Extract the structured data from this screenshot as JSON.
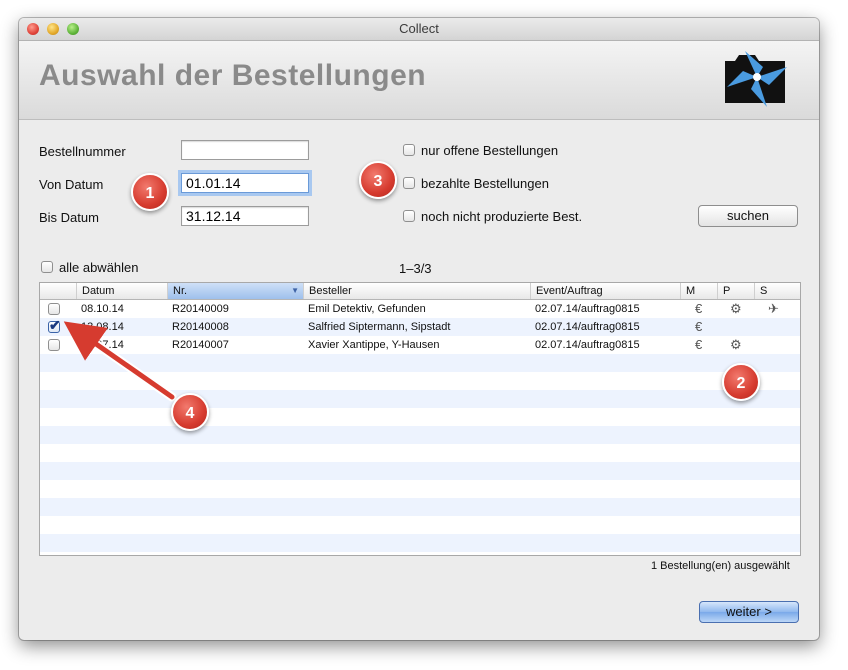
{
  "window": {
    "title": "Collect"
  },
  "header": {
    "title": "Auswahl der Bestellungen"
  },
  "form": {
    "order_number_label": "Bestellnummer",
    "order_number_value": "",
    "from_date_label": "Von Datum",
    "from_date_value": "01.01.14",
    "to_date_label": "Bis Datum",
    "to_date_value": "31.12.14"
  },
  "filters": {
    "open_orders": {
      "label": "nur offene Bestellungen",
      "checked": false
    },
    "paid_orders": {
      "label": "bezahlte Bestellungen",
      "checked": false
    },
    "not_produced": {
      "label": "noch nicht produzierte Best.",
      "checked": false
    },
    "search_button": "suchen"
  },
  "list": {
    "select_all_label": "alle abwählen",
    "counter": "1–3/3",
    "columns": [
      "Datum",
      "Nr.",
      "Besteller",
      "Event/Auftrag",
      "M",
      "P",
      "S"
    ],
    "rows": [
      {
        "checked": false,
        "date": "08.10.14",
        "nr": "R20140009",
        "customer": "Emil Detektiv, Gefunden",
        "event": "02.07.14/auftrag0815",
        "m": "€",
        "p": "⚙",
        "s": "✈"
      },
      {
        "checked": true,
        "date": "13.08.14",
        "nr": "R20140008",
        "customer": "Salfried Siptermann, Sipstadt",
        "event": "02.07.14/auftrag0815",
        "m": "€",
        "p": "",
        "s": ""
      },
      {
        "checked": false,
        "date": "02.07.14",
        "nr": "R20140007",
        "customer": "Xavier Xantippe, Y-Hausen",
        "event": "02.07.14/auftrag0815",
        "m": "€",
        "p": "⚙",
        "s": ""
      }
    ]
  },
  "status": {
    "selected_text": "1 Bestellung(en) ausgewählt"
  },
  "next_button": "weiter >",
  "badges": [
    "1",
    "2",
    "3",
    "4"
  ],
  "colors": {
    "badge": "#d63b2f",
    "selection": "#9ec0ec",
    "arrow": "#d63b2f"
  }
}
